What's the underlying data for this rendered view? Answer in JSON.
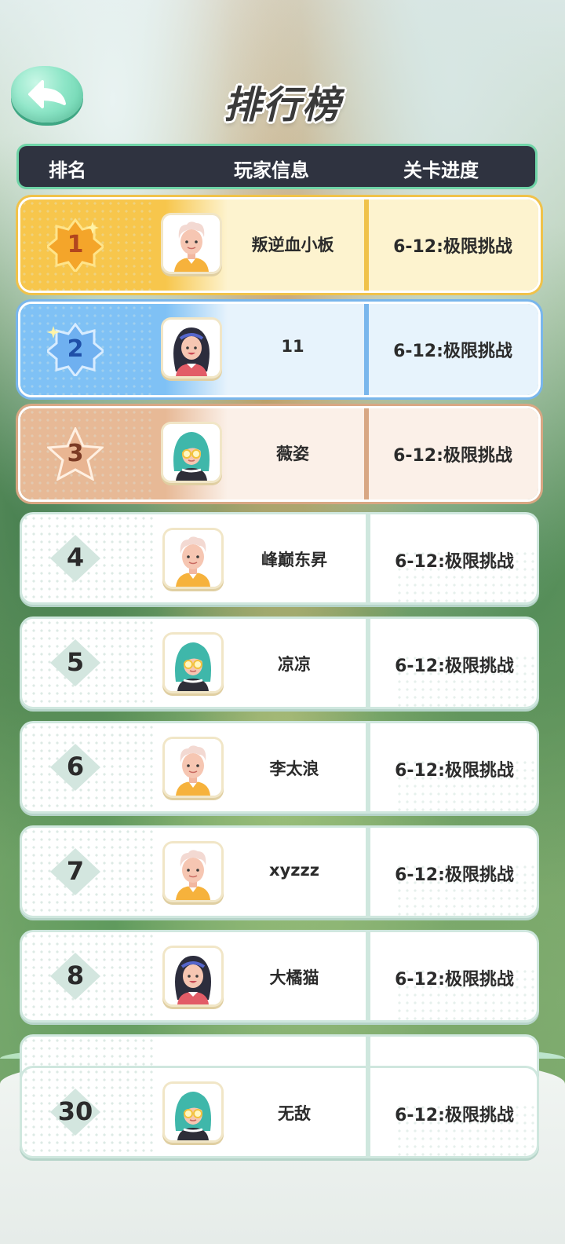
{
  "title": "排行榜",
  "header": {
    "rank": "排名",
    "player": "玩家信息",
    "progress": "关卡进度"
  },
  "rows": [
    {
      "rank": "1",
      "name": "叛逆血小板",
      "progress": "6-12:极限挑战",
      "avatar": "avatar-white-hair-boy-icon"
    },
    {
      "rank": "2",
      "name": "11",
      "progress": "6-12:极限挑战",
      "avatar": "avatar-dark-hair-girl-icon"
    },
    {
      "rank": "3",
      "name": "薇姿",
      "progress": "6-12:极限挑战",
      "avatar": "avatar-teal-hair-glasses-icon"
    },
    {
      "rank": "4",
      "name": "峰巅东昇",
      "progress": "6-12:极限挑战",
      "avatar": "avatar-white-hair-boy-icon"
    },
    {
      "rank": "5",
      "name": "凉凉",
      "progress": "6-12:极限挑战",
      "avatar": "avatar-teal-hair-glasses-icon"
    },
    {
      "rank": "6",
      "name": "李太浪",
      "progress": "6-12:极限挑战",
      "avatar": "avatar-white-hair-boy-icon"
    },
    {
      "rank": "7",
      "name": "xyzzz",
      "progress": "6-12:极限挑战",
      "avatar": "avatar-white-hair-boy-icon"
    },
    {
      "rank": "8",
      "name": "大橘猫",
      "progress": "6-12:极限挑战",
      "avatar": "avatar-dark-hair-girl-icon"
    }
  ],
  "my_row": {
    "rank": "30",
    "name": "无敌",
    "progress": "6-12:极限挑战",
    "avatar": "avatar-teal-hair-glasses-icon"
  },
  "colors": {
    "gold": "#f7c64c",
    "silver": "#7fc1f5",
    "bronze": "#e7b996",
    "header_bg": "#2f3340",
    "accent": "#6fd4a7"
  }
}
